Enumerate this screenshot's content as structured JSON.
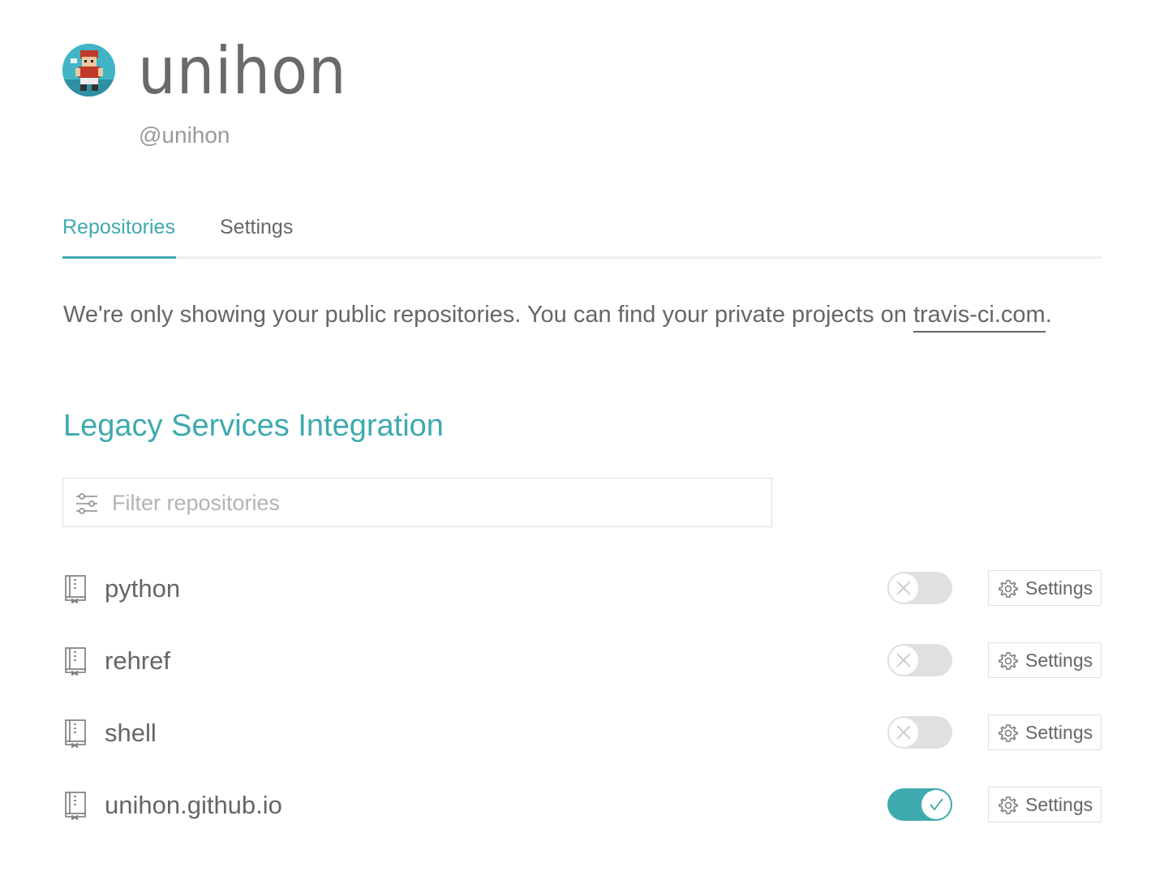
{
  "profile": {
    "name": "unihon",
    "handle": "@unihon"
  },
  "tabs": [
    {
      "label": "Repositories",
      "active": true
    },
    {
      "label": "Settings",
      "active": false
    }
  ],
  "notice": {
    "text": "We're only showing your public repositories. You can find your private projects on ",
    "link_text": "travis-ci.com",
    "suffix": "."
  },
  "section": {
    "title": "Legacy Services Integration"
  },
  "filter": {
    "placeholder": "Filter repositories",
    "value": ""
  },
  "repositories": [
    {
      "name": "python",
      "enabled": false,
      "settings_label": "Settings"
    },
    {
      "name": "rehref",
      "enabled": false,
      "settings_label": "Settings"
    },
    {
      "name": "shell",
      "enabled": false,
      "settings_label": "Settings"
    },
    {
      "name": "unihon.github.io",
      "enabled": true,
      "settings_label": "Settings"
    }
  ],
  "colors": {
    "accent": "#3eaaaf",
    "text": "#666666",
    "muted": "#9a9a9a",
    "toggle_off": "#e0e0e0"
  },
  "icons": {
    "avatar": "avatar-pixel-character",
    "filter": "filter-sliders-icon",
    "repo": "repo-book-icon",
    "toggle_off": "x-icon",
    "toggle_on": "check-icon",
    "settings": "gear-icon"
  }
}
